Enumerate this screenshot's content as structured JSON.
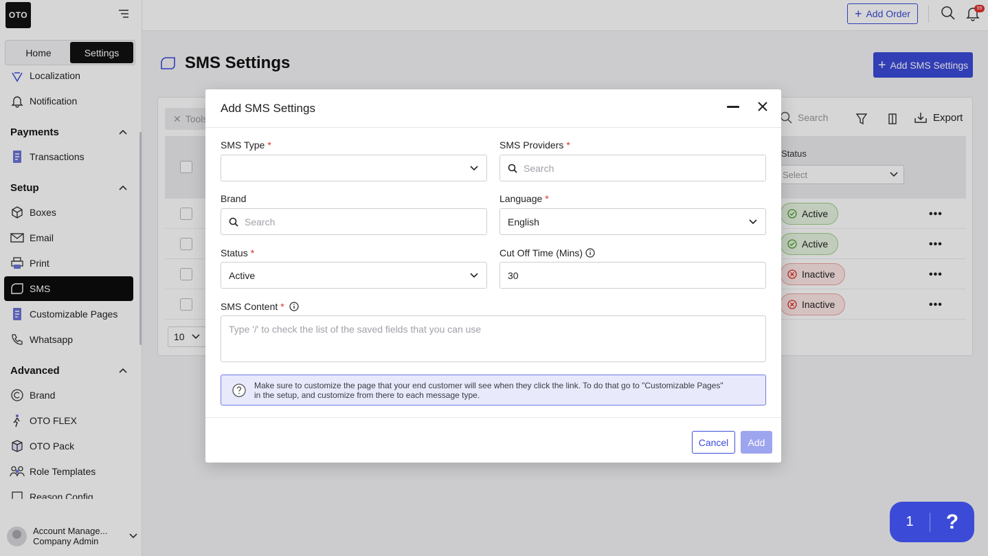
{
  "app": {
    "logo_text": "OTO"
  },
  "sidebar": {
    "segments": [
      {
        "label": "Home"
      },
      {
        "label": "Settings"
      }
    ],
    "items_top": [
      {
        "label": "Localization"
      },
      {
        "label": "Notification"
      }
    ],
    "groups": [
      {
        "label": "Payments"
      },
      {
        "label": "Setup"
      },
      {
        "label": "Advanced"
      }
    ],
    "payments_items": [
      {
        "label": "Transactions"
      }
    ],
    "setup_items": [
      {
        "label": "Boxes"
      },
      {
        "label": "Email"
      },
      {
        "label": "Print"
      },
      {
        "label": "SMS"
      },
      {
        "label": "Customizable Pages"
      },
      {
        "label": "Whatsapp"
      }
    ],
    "advanced_items": [
      {
        "label": "Brand"
      },
      {
        "label": "OTO FLEX"
      },
      {
        "label": "OTO Pack"
      },
      {
        "label": "Role Templates"
      },
      {
        "label": "Reason Config"
      }
    ],
    "account": {
      "name": "Account Manage...",
      "role": "Company Admin"
    }
  },
  "topbar": {
    "add_order_label": "Add Order",
    "notification_count": "99"
  },
  "page": {
    "title": "SMS Settings",
    "add_button_label": "Add SMS Settings",
    "toolbar": {
      "tools_label": "Tools",
      "search_placeholder": "Search",
      "export_label": "Export"
    },
    "table": {
      "status_header": "Status",
      "status_filter_placeholder": "Select",
      "rows": [
        {
          "status": "Active"
        },
        {
          "status": "Active"
        },
        {
          "status": "Inactive"
        },
        {
          "status": "Inactive"
        }
      ],
      "page_size": "10"
    }
  },
  "modal": {
    "title": "Add SMS Settings",
    "sms_type_label": "SMS Type",
    "sms_type_value": "",
    "sms_providers_label": "SMS Providers",
    "sms_providers_placeholder": "Search",
    "brand_label": "Brand",
    "brand_placeholder": "Search",
    "language_label": "Language",
    "language_value": "English",
    "status_label": "Status",
    "status_value": "Active",
    "cutoff_label": "Cut Off Time (Mins)",
    "cutoff_value": "30",
    "content_label": "SMS Content",
    "content_placeholder": "Type '/' to check the list of the saved fields that you can use",
    "info_line1": "Make sure to customize the page that your end customer will see when they click the link. To do that go to \"Customizable Pages\"",
    "info_line2": "in the setup, and customize from there to each message type.",
    "cancel_label": "Cancel",
    "add_label": "Add",
    "required_mark": "*"
  },
  "help_widget": {
    "count": "1",
    "icon": "?"
  },
  "colors": {
    "accent": "#3b4bd8",
    "active_bg": "#e6f4e0",
    "inactive_bg": "#fde8e6"
  }
}
